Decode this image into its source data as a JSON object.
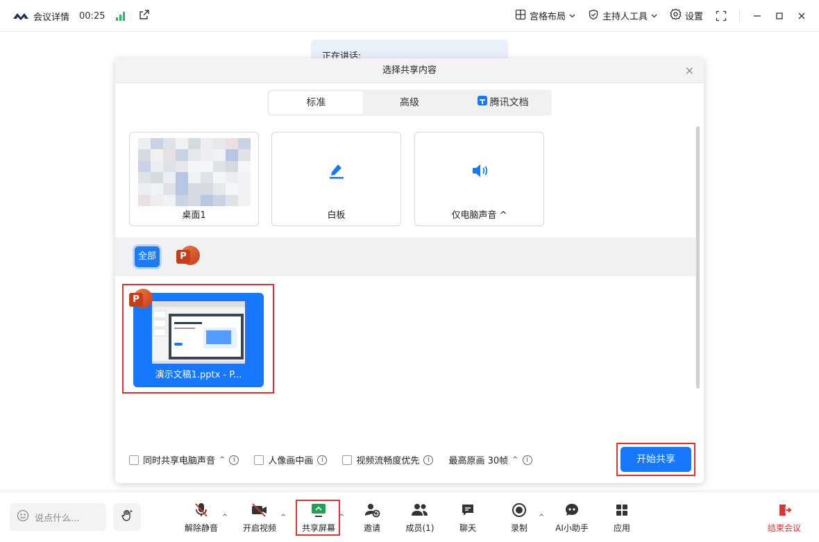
{
  "titlebar": {
    "meeting_details": "会议详情",
    "timer": "00:25",
    "layout": "宫格布局",
    "host_tools": "主持人工具",
    "settings": "设置"
  },
  "speaking": {
    "text": "正在讲话:"
  },
  "dialog": {
    "title": "选择共享内容",
    "tabs": [
      {
        "label": "标准",
        "active": true
      },
      {
        "label": "高级",
        "active": false
      },
      {
        "label": "腾讯文档",
        "active": false
      }
    ],
    "cards": [
      {
        "label": "桌面1",
        "icon": "desktop-thumbnail"
      },
      {
        "label": "白板",
        "icon": "pen-icon"
      },
      {
        "label": "仅电脑声音 ^",
        "icon": "speaker-icon"
      }
    ],
    "filter": {
      "all_label": "全部"
    },
    "window_item": {
      "label": "演示文稿1.pptx - P..."
    },
    "options": [
      {
        "label": "同时共享电脑声音",
        "checked": false
      },
      {
        "label": "人像画中画",
        "checked": false
      },
      {
        "label": "视频流畅度优先",
        "checked": false
      }
    ],
    "quality": "最高原画 30帧",
    "start_button": "开始共享"
  },
  "toolbar": {
    "say_placeholder": "说点什么...",
    "buttons": [
      {
        "label": "解除静音",
        "icon": "mic-muted-icon"
      },
      {
        "label": "开启视频",
        "icon": "video-off-icon"
      },
      {
        "label": "共享屏幕",
        "icon": "share-screen-icon"
      },
      {
        "label": "邀请",
        "icon": "invite-icon"
      },
      {
        "label": "成员(1)",
        "icon": "members-icon"
      },
      {
        "label": "聊天",
        "icon": "chat-icon"
      },
      {
        "label": "录制",
        "icon": "record-icon"
      },
      {
        "label": "AI小助手",
        "icon": "ai-assistant-icon"
      },
      {
        "label": "应用",
        "icon": "apps-icon"
      }
    ],
    "end_label": "结束会议"
  },
  "colors": {
    "accent": "#1677ff",
    "danger": "#e23131",
    "signal": "#21c05b"
  }
}
